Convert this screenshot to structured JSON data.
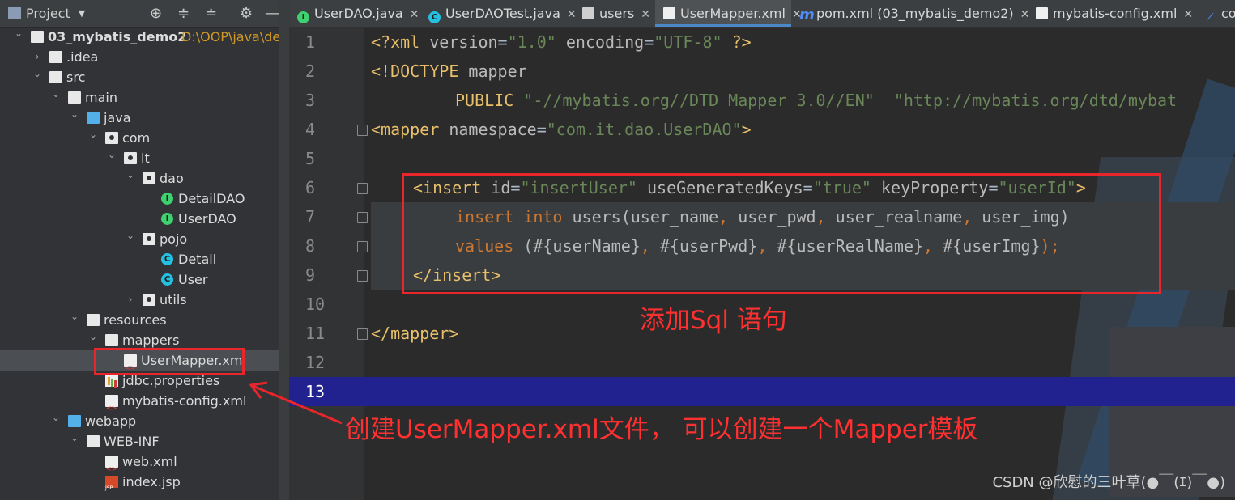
{
  "project_panel": {
    "title": "Project",
    "tree": [
      {
        "label": "03_mybatis_demo2",
        "path": "D:\\OOP\\java\\deve",
        "icon": "folder-icon",
        "arrow": "expanded"
      },
      {
        "label": ".idea",
        "icon": "folder-icon",
        "arrow": "collapsed"
      },
      {
        "label": "src",
        "icon": "folder-icon",
        "arrow": "expanded"
      },
      {
        "label": "main",
        "icon": "folder-icon",
        "arrow": "expanded"
      },
      {
        "label": "java",
        "icon": "source-folder-icon",
        "arrow": "expanded"
      },
      {
        "label": "com",
        "icon": "package-icon",
        "arrow": "expanded"
      },
      {
        "label": "it",
        "icon": "package-icon",
        "arrow": "expanded"
      },
      {
        "label": "dao",
        "icon": "package-icon",
        "arrow": "expanded"
      },
      {
        "label": "DetailDAO",
        "icon": "interface-icon",
        "arrow": "none"
      },
      {
        "label": "UserDAO",
        "icon": "interface-icon",
        "arrow": "none"
      },
      {
        "label": "pojo",
        "icon": "package-icon",
        "arrow": "expanded"
      },
      {
        "label": "Detail",
        "icon": "class-icon",
        "arrow": "none"
      },
      {
        "label": "User",
        "icon": "class-icon",
        "arrow": "none"
      },
      {
        "label": "utils",
        "icon": "package-icon",
        "arrow": "collapsed"
      },
      {
        "label": "resources",
        "icon": "resources-folder-icon",
        "arrow": "expanded"
      },
      {
        "label": "mappers",
        "icon": "folder-icon",
        "arrow": "expanded"
      },
      {
        "label": "UserMapper.xml",
        "icon": "xml-file-icon",
        "arrow": "none"
      },
      {
        "label": "jdbc.properties",
        "icon": "properties-file-icon",
        "arrow": "none"
      },
      {
        "label": "mybatis-config.xml",
        "icon": "xml-file-icon",
        "arrow": "none"
      },
      {
        "label": "webapp",
        "icon": "web-folder-icon",
        "arrow": "expanded"
      },
      {
        "label": "WEB-INF",
        "icon": "folder-icon",
        "arrow": "expanded"
      },
      {
        "label": "web.xml",
        "icon": "xml-file-icon",
        "arrow": "none"
      },
      {
        "label": "index.jsp",
        "icon": "jsp-file-icon",
        "arrow": "none"
      }
    ]
  },
  "tabs": [
    {
      "label": "UserDAO.java",
      "icon": "interface-icon"
    },
    {
      "label": "UserDAOTest.java",
      "icon": "class-icon"
    },
    {
      "label": "users",
      "icon": "table-icon"
    },
    {
      "label": "UserMapper.xml",
      "icon": "xml-file-icon",
      "active": true
    },
    {
      "label": "pom.xml (03_mybatis_demo2)",
      "icon": "maven-icon"
    },
    {
      "label": "mybatis-config.xml",
      "icon": "xml-file-icon"
    },
    {
      "label": "co",
      "icon": "db-icon"
    }
  ],
  "editor": {
    "line_numbers": [
      "1",
      "2",
      "3",
      "4",
      "5",
      "6",
      "7",
      "8",
      "9",
      "10",
      "11",
      "12",
      "13"
    ],
    "line1": {
      "p1": "<?xml ",
      "a1": "version",
      "eq1": "=",
      "v1": "\"1.0\"",
      "sp": " ",
      "a2": "encoding",
      "eq2": "=",
      "v2": "\"UTF-8\"",
      "end": " ?>"
    },
    "line2": {
      "t": "<!DOCTYPE ",
      "rest": "mapper"
    },
    "line3": {
      "kw": "PUBLIC ",
      "s1": "\"-//mybatis.org//DTD Mapper 3.0//EN\"",
      "gap": "  ",
      "s2": "\"http://mybatis.org/dtd/mybat"
    },
    "line4": {
      "t": "<mapper ",
      "a": "namespace",
      "eq": "=",
      "v": "\"com.it.dao.UserDAO\"",
      "c": ">"
    },
    "line6": {
      "t": "<insert ",
      "a1": "id",
      "eq1": "=",
      "v1": "\"insertUser\"",
      "a2": " useGeneratedKeys",
      "eq2": "=",
      "v2": "\"true\"",
      "a3": " keyProperty",
      "eq3": "=",
      "v3": "\"userId\"",
      "c": ">"
    },
    "line7": {
      "k1": "insert ",
      "k2": "into ",
      "tbl": "users(",
      "c1": "user_name",
      "cm1": ", ",
      "c2": "user_pwd",
      "cm2": ", ",
      "c3": "user_realname",
      "cm3": ", ",
      "c4": "user_img",
      "cp": ")"
    },
    "line8": {
      "k": "values ",
      "p": "(",
      "s1": "#{userName}",
      "cm1": ", ",
      "s2": "#{userPwd}",
      "cm2": ", ",
      "s3": "#{userRealName}",
      "cm3": ", ",
      "s4": "#{userImg}",
      "end": ");"
    },
    "line9": {
      "t": "</insert>"
    },
    "line11": {
      "t": "</mapper>"
    }
  },
  "annotations": {
    "sql_note": "添加Sql 语句",
    "file_note": "创建UserMapper.xml文件， 可以创建一个Mapper模板"
  },
  "watermark": "CSDN @欣慰的三叶草(●￣(ｴ)￣●)",
  "colors": {
    "accent": "#4a88c7",
    "annotation": "#e8262c"
  }
}
